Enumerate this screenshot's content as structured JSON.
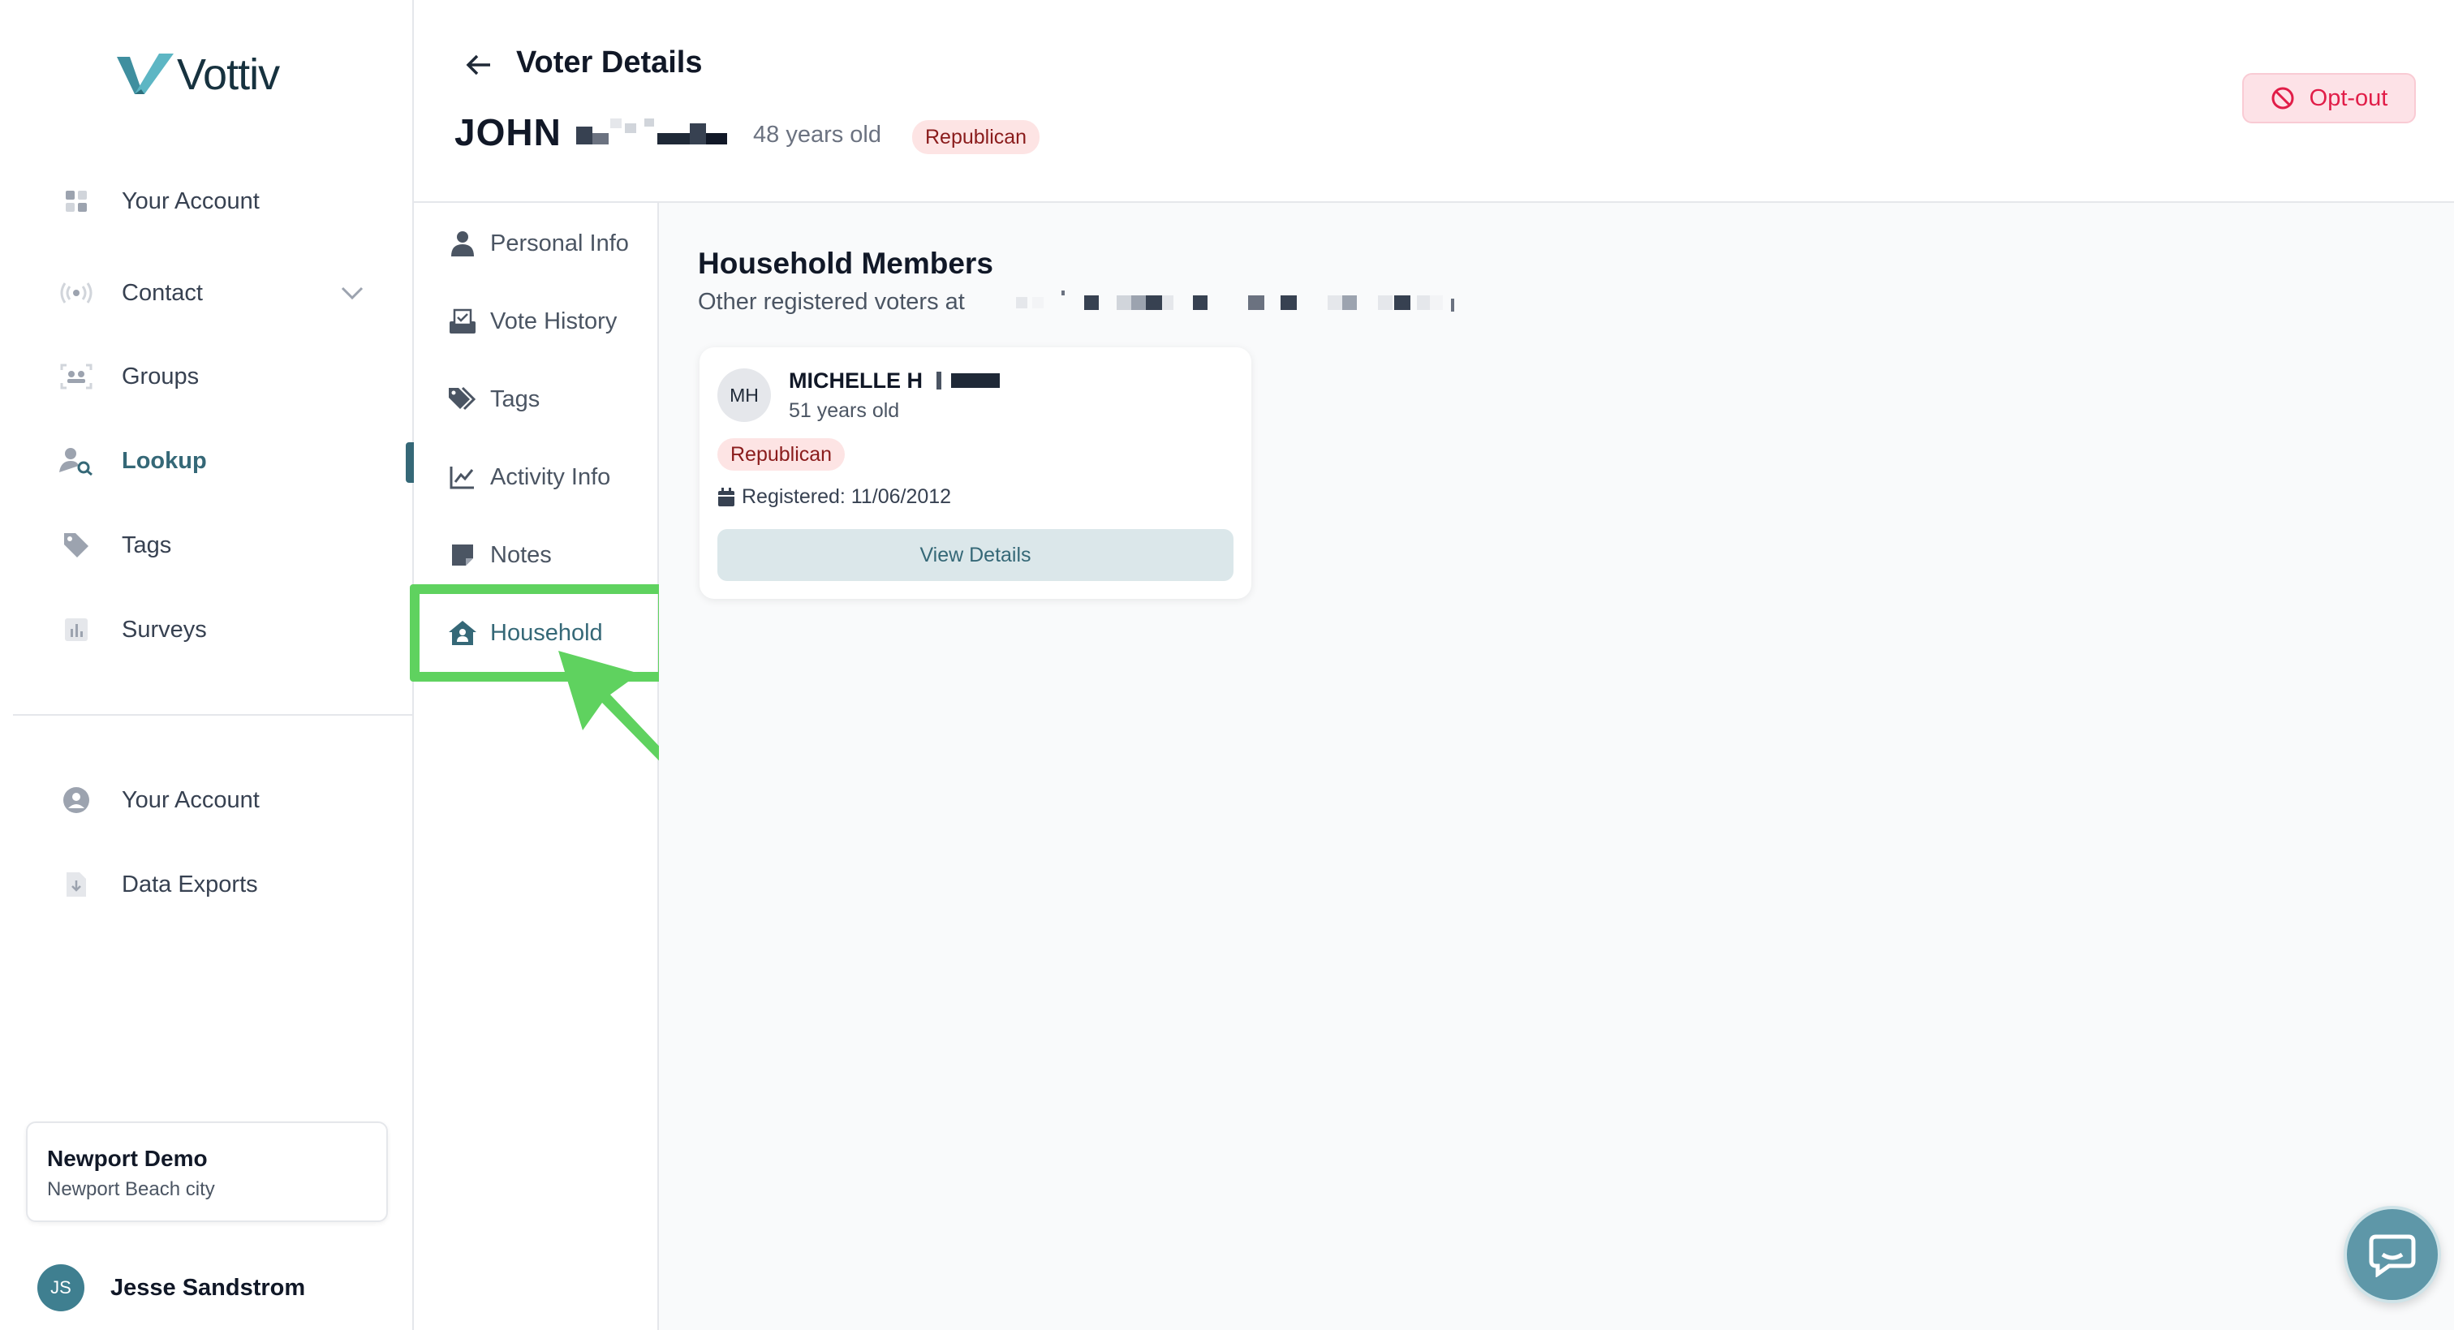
{
  "app": {
    "logo_text": "Vottiv"
  },
  "sidebar": {
    "items": [
      {
        "label": "Your Account",
        "icon": "grid-icon"
      },
      {
        "label": "Contact",
        "icon": "broadcast-icon"
      },
      {
        "label": "Groups",
        "icon": "group-icon"
      },
      {
        "label": "Lookup",
        "icon": "user-search-icon"
      },
      {
        "label": "Tags",
        "icon": "tag-icon"
      },
      {
        "label": "Surveys",
        "icon": "bar-chart-icon"
      }
    ],
    "bottom_items": [
      {
        "label": "Your Account",
        "icon": "user-circle-icon"
      },
      {
        "label": "Data Exports",
        "icon": "download-file-icon"
      }
    ],
    "org": {
      "name": "Newport Demo",
      "subtitle": "Newport Beach city"
    },
    "user": {
      "initials": "JS",
      "name": "Jesse Sandstrom"
    }
  },
  "header": {
    "title": "Voter Details",
    "voter_first_name": "JOHN",
    "age": "48 years old",
    "party": "Republican",
    "optout_label": "Opt-out"
  },
  "subnav": {
    "items": [
      {
        "label": "Personal Info",
        "icon": "person-icon"
      },
      {
        "label": "Vote History",
        "icon": "ballot-icon"
      },
      {
        "label": "Tags",
        "icon": "tags-icon"
      },
      {
        "label": "Activity Info",
        "icon": "line-chart-icon"
      },
      {
        "label": "Notes",
        "icon": "note-icon"
      },
      {
        "label": "Household",
        "icon": "house-user-icon"
      }
    ],
    "active": "Household"
  },
  "main": {
    "section_title": "Household Members",
    "section_subtitle": "Other registered voters at",
    "members": [
      {
        "initials": "MH",
        "name": "MICHELLE H",
        "age": "51 years old",
        "party": "Republican",
        "registered": "Registered: 11/06/2012",
        "button_label": "View Details"
      }
    ]
  },
  "colors": {
    "brand": "#356877",
    "highlight": "#5fd25f",
    "party_bg": "#fde4e4",
    "party_text": "#8a1c1c",
    "optout": "#e11d48"
  }
}
